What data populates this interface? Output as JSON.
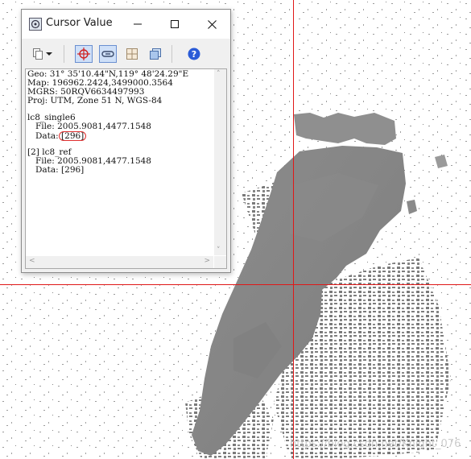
{
  "window": {
    "title": "Cursor Value",
    "controls": {
      "minimize": "minimize",
      "maximize": "maximize",
      "close": "close"
    }
  },
  "toolbar": {
    "icons": [
      "copy-icon",
      "dropdown-arrow-icon",
      "crosshair-icon",
      "link-icon",
      "grid-icon",
      "layers-icon",
      "help-icon"
    ],
    "active": [
      "crosshair-icon",
      "link-icon"
    ],
    "accent": "#3a6fd8"
  },
  "info": {
    "geo": "Geo: 31° 35'10.44\"N,119° 48'24.29\"E",
    "map": "Map: 196962.2424,3499000.3564",
    "mgrs": "MGRS: 50RQV6634497993",
    "proj": "Proj: UTM, Zone 51 N, WGS-84"
  },
  "layers": [
    {
      "name": "lc8_single6",
      "file": "File: 2005.9081,4477.1548",
      "data_label": "Data: ",
      "data_value": "[296]"
    },
    {
      "name": "[2] lc8_ref",
      "file": "File: 2005.9081,4477.1548",
      "data_label": "Data: ",
      "data_value": "[296]"
    }
  ],
  "highlight_color": "#e03030",
  "crosshair_color": "#e01818",
  "watermark": "https://blog.csdn.net/Knight_076"
}
